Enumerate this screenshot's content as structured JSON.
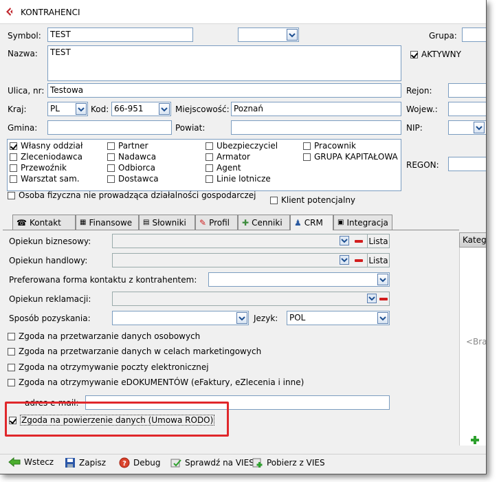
{
  "window": {
    "title": "KONTRAHENCI"
  },
  "fields": {
    "symbol_label": "Symbol:",
    "symbol_value": "TEST",
    "grupa_label": "Grupa:",
    "nazwa_label": "Nazwa:",
    "nazwa_value": "TEST",
    "aktywny_label": "AKTYWNY",
    "ulica_label": "Ulica, nr:",
    "ulica_value": "Testowa",
    "rejon_label": "Rejon:",
    "kraj_label": "Kraj:",
    "kraj_value": "PL",
    "kod_label": "Kod:",
    "kod_value": "66-951",
    "miejscowosc_label": "Miejscowość:",
    "miejscowosc_value": "Poznań",
    "wojew_label": "Wojew.:",
    "gmina_label": "Gmina:",
    "powiat_label": "Powiat:",
    "nip_label": "NIP:",
    "regon_label": "REGON:"
  },
  "types": [
    {
      "label": "Własny oddział",
      "checked": true
    },
    {
      "label": "Zleceniodawca",
      "checked": false
    },
    {
      "label": "Przewoźnik",
      "checked": false
    },
    {
      "label": "Warsztat sam.",
      "checked": false
    },
    {
      "label": "Partner",
      "checked": false
    },
    {
      "label": "Nadawca",
      "checked": false
    },
    {
      "label": "Odbiorca",
      "checked": false
    },
    {
      "label": "Dostawca",
      "checked": false
    },
    {
      "label": "Ubezpieczyciel",
      "checked": false
    },
    {
      "label": "Armator",
      "checked": false
    },
    {
      "label": "Agent",
      "checked": false
    },
    {
      "label": "Linie lotnicze",
      "checked": false
    },
    {
      "label": "Pracownik",
      "checked": false
    },
    {
      "label": "GRUPA KAPITAŁOWA",
      "checked": false
    }
  ],
  "osoba_fizyczna": "Osoba fizyczna nie prowadząca działalności gospodarczej",
  "klient_potencjalny": "Klient potencjalny",
  "tabs": [
    "Kontakt",
    "Finansowe",
    "Słowniki",
    "Profil",
    "Cenniki",
    "CRM",
    "Integracja"
  ],
  "active_tab": "CRM",
  "crm": {
    "opiekun_biznesowy": "Opiekun biznesowy:",
    "opiekun_handlowy": "Opiekun handlowy:",
    "lista": "Lista",
    "preferowana": "Preferowana forma kontaktu z kontrahentem:",
    "opiekun_reklamacji": "Opiekun reklamacji:",
    "sposob": "Sposób pozyskania:",
    "jezyk_label": "Jezyk:",
    "jezyk_value": "POL",
    "zgoda1": "Zgoda na przetwarzanie danych osobowych",
    "zgoda2": "Zgoda na przetwarzanie danych w celach marketingowych",
    "zgoda3": "Zgoda na otrzymywanie poczty elektronicznej",
    "zgoda4": "Zgoda na otrzymywanie eDOKUMENTÓW (eFaktury, eZlecenia i inne)",
    "adres_email": "adres e-mail:",
    "rodo": "Zgoda na powierzenie danych (Umowa RODO)"
  },
  "right_panel": {
    "header": "Kateg",
    "placeholder": "<Bra"
  },
  "bottom": {
    "wstecz": "Wstecz",
    "zapisz": "Zapisz",
    "debug": "Debug",
    "vies": "Sprawdź na VIES",
    "pobierz": "Pobierz z VIES"
  },
  "colors": {
    "accent": "#7a9cc0",
    "highlight": "#e0272b"
  }
}
